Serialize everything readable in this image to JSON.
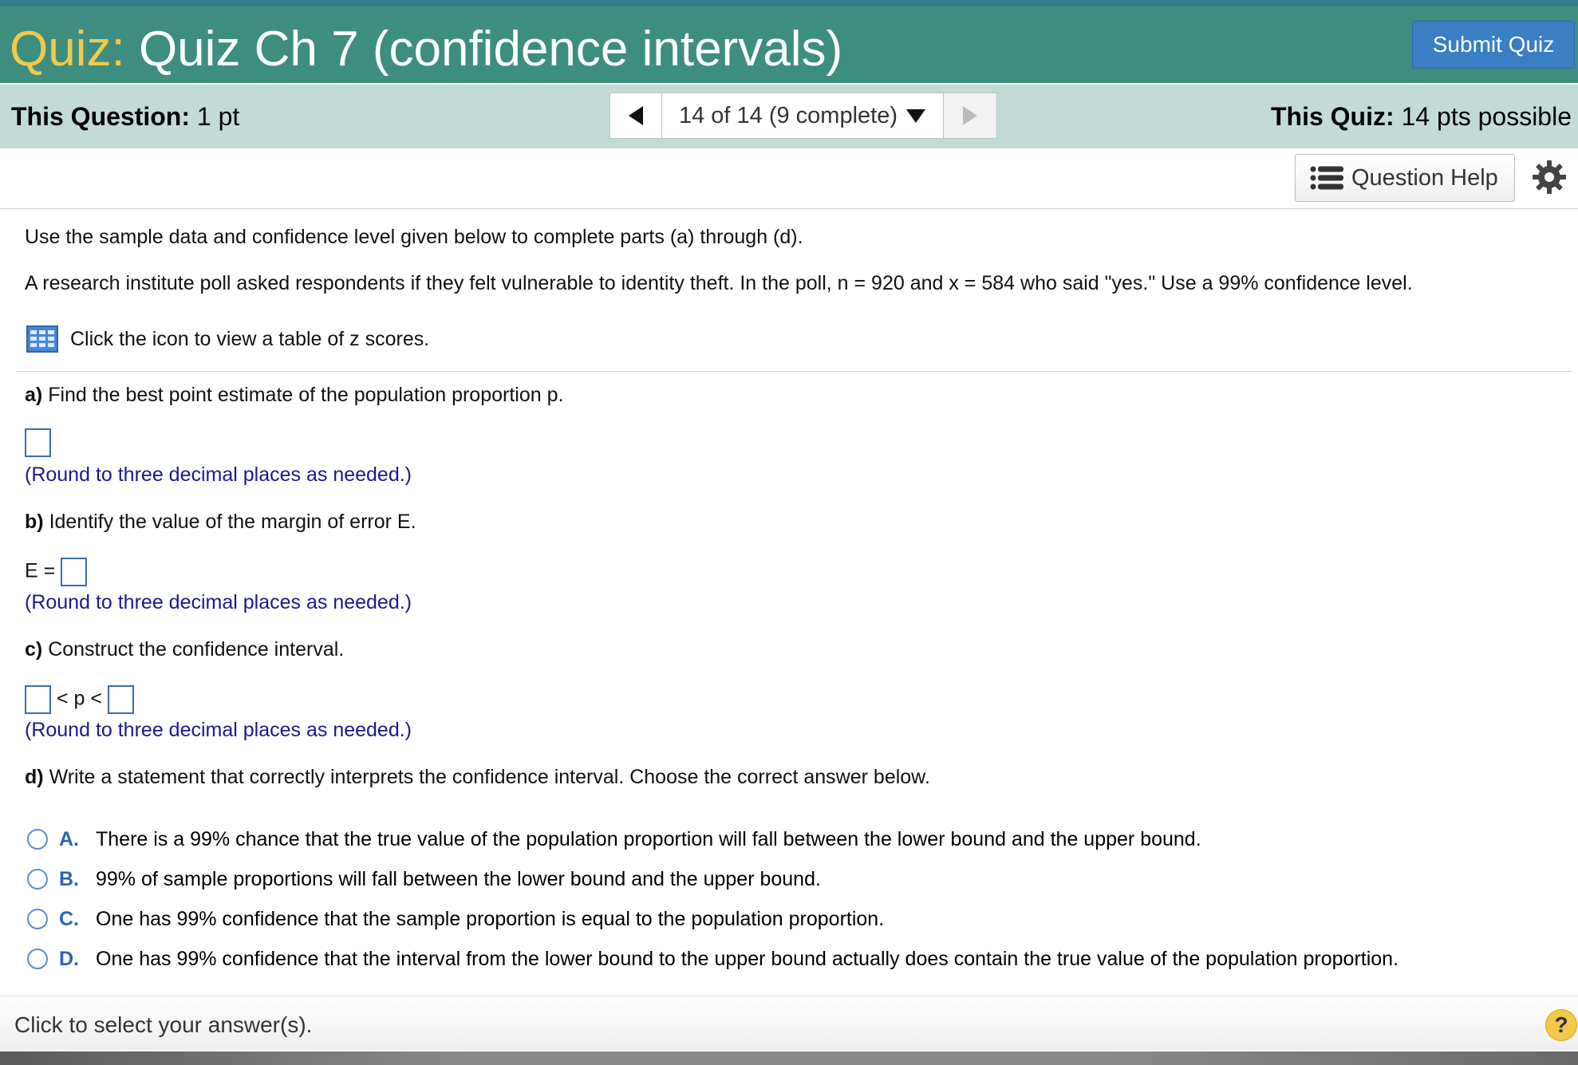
{
  "header": {
    "title_prefix": "Quiz:",
    "title": "Quiz Ch 7 (confidence intervals)",
    "submit_label": "Submit Quiz"
  },
  "infobar": {
    "question_label": "This Question:",
    "question_value": "1 pt",
    "nav_status": "14 of 14 (9 complete)",
    "quiz_label": "This Quiz:",
    "quiz_value": "14 pts possible"
  },
  "toolbar": {
    "help_label": "Question Help"
  },
  "question": {
    "intro": "Use the sample data and confidence level given below to complete parts (a) through (d).",
    "prompt": "A research institute poll asked respondents if they felt vulnerable to identity theft. In the poll, n = 920 and x = 584 who said \"yes.\" Use a 99% confidence level.",
    "table_link": "Click the icon to view a table of z scores.",
    "part_a_label": "a)",
    "part_a_text": "Find the best point estimate of the population proportion p.",
    "hint_a": "(Round to three decimal places as needed.)",
    "part_b_label": "b)",
    "part_b_text": "Identify the value of the margin of error E.",
    "e_label": "E =",
    "hint_b": "(Round to three decimal places as needed.)",
    "part_c_label": "c)",
    "part_c_text": "Construct the confidence interval.",
    "ci_middle": "< p <",
    "hint_c": "(Round to three decimal places as needed.)",
    "part_d_label": "d)",
    "part_d_text": "Write a statement that correctly interprets the confidence interval. Choose the correct answer below.",
    "options": [
      {
        "letter": "A.",
        "text": "There is a 99% chance that the true value of the population proportion will fall between the lower bound and the upper bound."
      },
      {
        "letter": "B.",
        "text": "99% of sample proportions will fall between the lower bound and the upper bound."
      },
      {
        "letter": "C.",
        "text": "One has 99% confidence that the sample proportion is equal to the population proportion."
      },
      {
        "letter": "D.",
        "text": "One has 99% confidence that the interval from the lower bound to the upper bound actually does contain the true value of the population proportion."
      }
    ]
  },
  "footer": {
    "text": "Click to select your answer(s).",
    "help_symbol": "?"
  },
  "colors": {
    "header_bg": "#3d8e7e",
    "title_prefix": "#f2c94c",
    "submit_bg": "#3a7ec4",
    "infobar_bg": "#c3dbd7",
    "hint_text": "#1a1a8c",
    "option_letter": "#2e63b8"
  },
  "icons": [
    "left-arrow-icon",
    "dropdown-triangle-icon",
    "right-arrow-icon",
    "list-icon",
    "gear-icon",
    "table-icon",
    "help-icon"
  ]
}
